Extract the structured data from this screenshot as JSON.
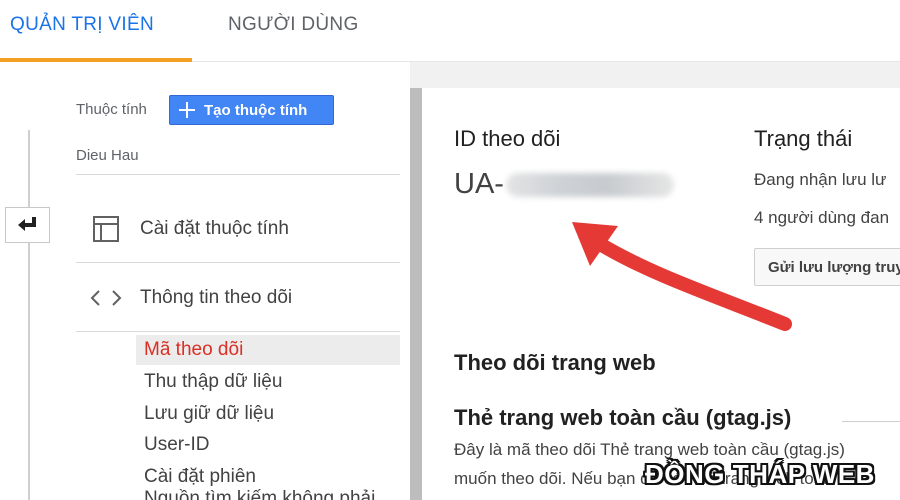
{
  "tabs": [
    {
      "label": "QUẢN TRỊ VIÊN",
      "active": true
    },
    {
      "label": "NGƯỜI DÙNG",
      "active": false
    }
  ],
  "property": {
    "label": "Thuộc tính",
    "create_button": "Tạo thuộc tính",
    "selected_name": "Dieu Hau"
  },
  "menu": [
    {
      "label": "Cài đặt thuộc tính",
      "icon": "layout-icon"
    },
    {
      "label": "Thông tin theo dõi",
      "icon": "code-icon"
    }
  ],
  "submenu": [
    {
      "label": "Mã theo dõi",
      "active": true
    },
    {
      "label": "Thu thập dữ liệu",
      "active": false
    },
    {
      "label": "Lưu giữ dữ liệu",
      "active": false
    },
    {
      "label": "User-ID",
      "active": false
    },
    {
      "label": "Cài đặt phiên",
      "active": false
    },
    {
      "label": "Nguồn tìm kiếm không phải",
      "active": false
    }
  ],
  "tracking": {
    "id_heading": "ID theo dõi",
    "id_prefix": "UA-",
    "status_heading": "Trạng thái",
    "status_line_1": "Đang nhận lưu lư",
    "status_line_2": "4 người dùng đan",
    "send_button": "Gửi lưu lượng truy",
    "web_heading": "Theo dõi trang web",
    "gtag_heading": "Thẻ trang web toàn cầu (gtag.js)",
    "description_1": "Đây là mã theo dõi Thẻ trang web toàn cầu (gtag.js)",
    "description_2": "muốn theo dõi. Nếu bạn đã có Thẻ trang web toàn c"
  },
  "watermark": "ĐỒNG THÁP WEB",
  "colors": {
    "accent": "#1a73e8",
    "tab_underline": "#f4a025",
    "button_blue": "#4285f4",
    "active_sub": "#d93025",
    "arrow": "#e53935"
  }
}
